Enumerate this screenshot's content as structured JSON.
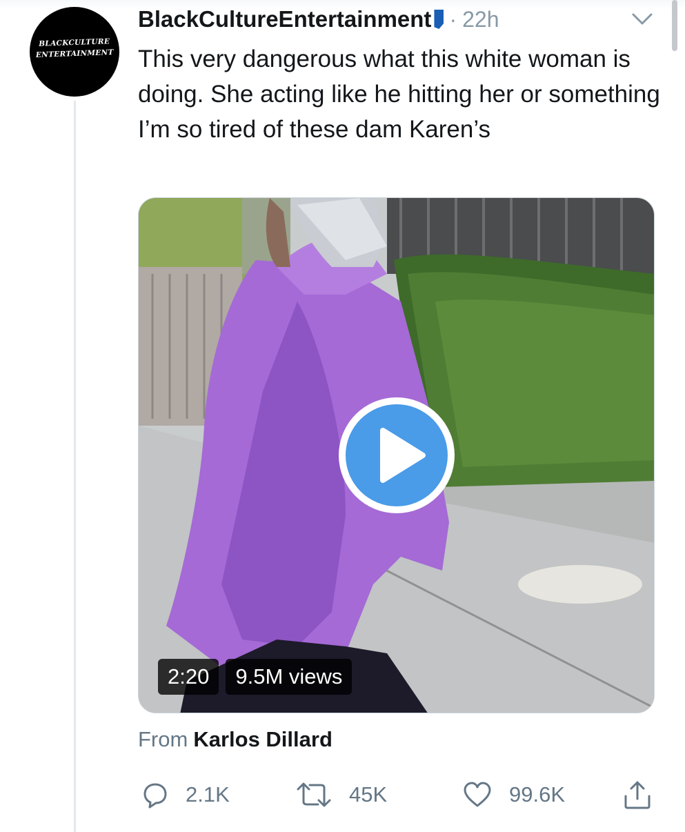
{
  "tweet": {
    "author_name": "BlackCultureEntertainment",
    "time_ago": "22h",
    "separator": "·",
    "text": "This very dangerous what this white woman is doing. She acting like he hitting her or something I’m so tired of these dam Karen’s",
    "avatar_text_line1": "BLACKCULTURE",
    "avatar_text_line2": "ENTERTAINMENT"
  },
  "media": {
    "duration": "2:20",
    "views": "9.5M views",
    "play_icon": "play-icon"
  },
  "source": {
    "prefix": "From",
    "name": "Karlos Dillard"
  },
  "actions": {
    "reply_count": "2.1K",
    "retweet_count": "45K",
    "like_count": "99.6K"
  },
  "colors": {
    "text": "#14171a",
    "muted": "#657786",
    "accent": "#1da1f2",
    "play_button": "#4a9be8"
  },
  "icons": [
    "chevron-down-icon",
    "flag-icon",
    "play-icon",
    "reply-icon",
    "retweet-icon",
    "like-icon",
    "share-icon"
  ]
}
